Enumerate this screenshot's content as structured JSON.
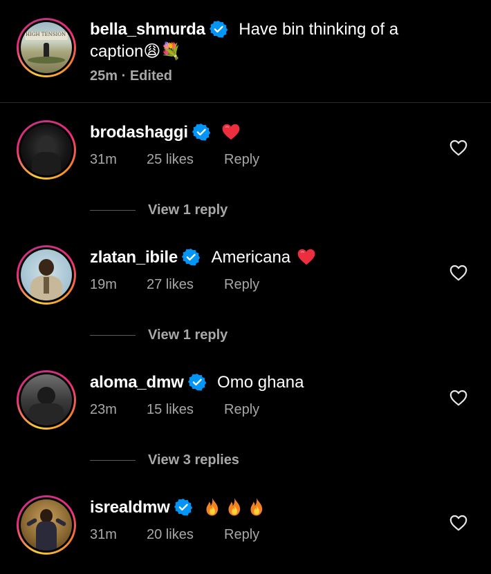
{
  "caption": {
    "username": "bella_shmurda",
    "text_line1": "Have bin thinking of a",
    "text_line2": "caption",
    "emoji": "😩💐",
    "time": "25m",
    "edited": "Edited",
    "separator": "·",
    "avatar_sign_text": "HIGH TENSION 2.0"
  },
  "comments": [
    {
      "username": "brodashaggi",
      "text": "",
      "emoji": "❤️",
      "time": "31m",
      "likes": "25 likes",
      "reply": "Reply",
      "view_replies": "View 1 reply"
    },
    {
      "username": "zlatan_ibile",
      "text": "Americana",
      "emoji": "❤️",
      "time": "19m",
      "likes": "27 likes",
      "reply": "Reply",
      "view_replies": "View 1 reply"
    },
    {
      "username": "aloma_dmw",
      "text": "Omo ghana",
      "emoji": "",
      "time": "23m",
      "likes": "15 likes",
      "reply": "Reply",
      "view_replies": "View 3 replies"
    },
    {
      "username": "isrealdmw",
      "text": "",
      "emoji": "🔥🔥🔥",
      "time": "31m",
      "likes": "20 likes",
      "reply": "Reply",
      "view_replies": ""
    }
  ],
  "colors": {
    "verified": "#0095f6",
    "heart_red": "#ed2e3e",
    "meta_gray": "#a8a8a8",
    "background": "#000000"
  },
  "icons": {
    "verified": "verified-badge-icon",
    "like": "heart-outline-icon",
    "fire": "fire-emoji",
    "heart": "red-heart-emoji"
  }
}
